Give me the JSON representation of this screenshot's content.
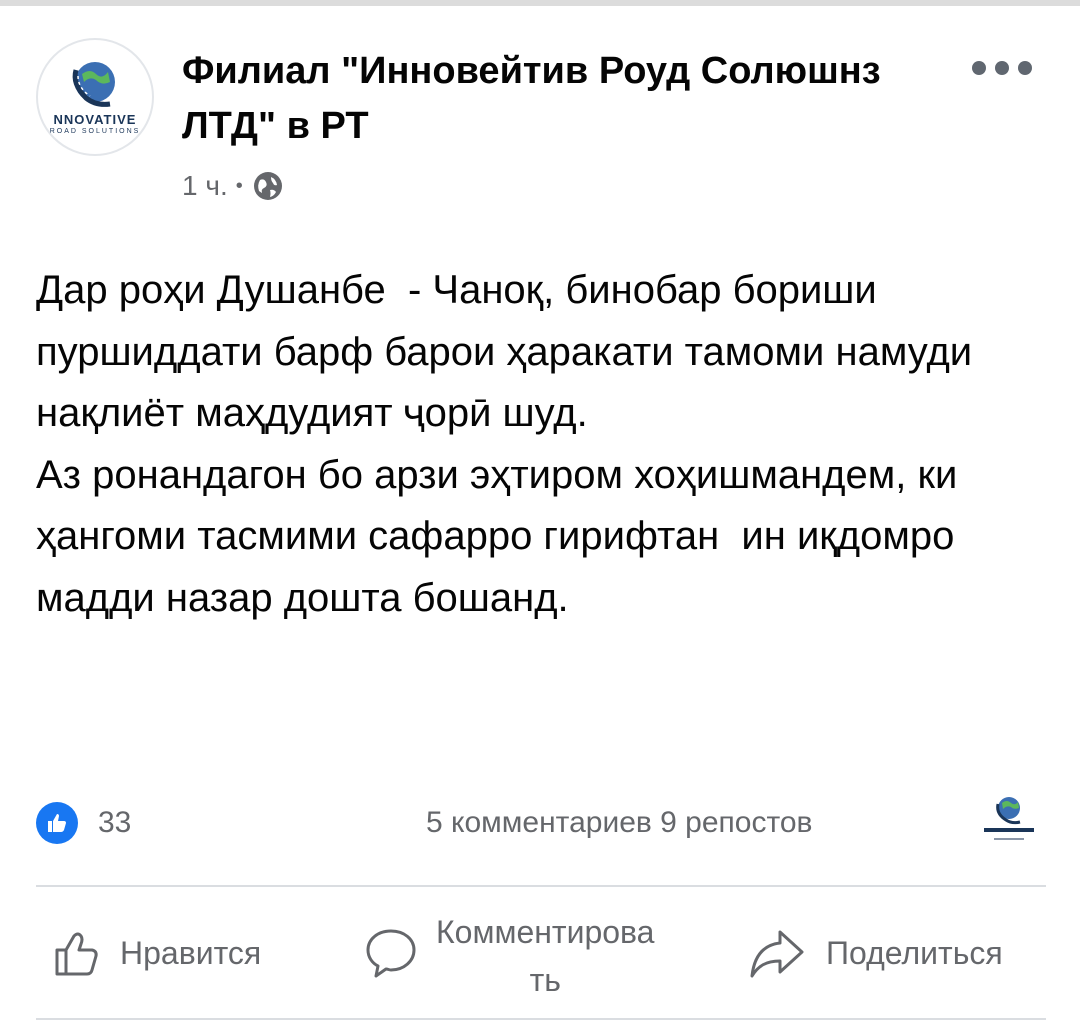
{
  "post": {
    "page_name": "Филиал \"Инновейтив Роуд Солюшнз ЛТД\" в РТ",
    "time": "1 ч.",
    "separator": "•",
    "avatar_logo_text": "NNOVATIVE",
    "avatar_logo_sub": "ROAD SOLUTIONS",
    "text": "Дар роҳи Душанбе  - Чаноқ, бинобар бориши пуршиддати барф барои ҳаракати тамоми намуди нақлиёт маҳдудият ҷорӣ шуд.\nАз ронандагон бо арзи эҳтиром хоҳишмандем, ки ҳангоми тасмими сафарро гирифтан  ин иқдомро  мадди назар дошта бошанд."
  },
  "stats": {
    "likes": "33",
    "comments_shares": "5 комментариев 9 репостов"
  },
  "actions": {
    "like": "Нравится",
    "comment_line1": "Комментирова",
    "comment_line2": "ть",
    "share": "Поделиться"
  },
  "colors": {
    "primary_text": "#050505",
    "secondary_text": "#65676b",
    "like_blue": "#1877f2",
    "divider": "#dadde1"
  },
  "icons": {
    "menu": "more-dots-icon",
    "privacy": "globe-icon",
    "reaction": "like-reaction-icon",
    "like_button": "thumbs-up-icon",
    "comment_button": "speech-bubble-icon",
    "share_button": "share-arrow-icon"
  }
}
